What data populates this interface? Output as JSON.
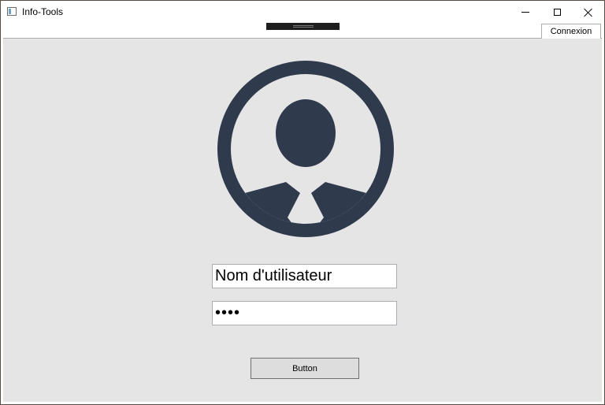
{
  "window": {
    "title": "Info-Tools",
    "icon": "app-window-icon",
    "controls": {
      "minimize_icon": "minimize-icon",
      "maximize_icon": "maximize-icon",
      "close_icon": "close-icon"
    }
  },
  "tabs": [
    {
      "label": "Connexion",
      "selected": true
    }
  ],
  "login": {
    "avatar_icon": "user-avatar-icon",
    "avatar_color": "#2f3a4c",
    "username_value": "Nom d'utilisateur",
    "password_value": "abcd",
    "submit_label": "Button"
  },
  "colors": {
    "background": "#e5e5e5",
    "avatar": "#2f3a4c"
  }
}
